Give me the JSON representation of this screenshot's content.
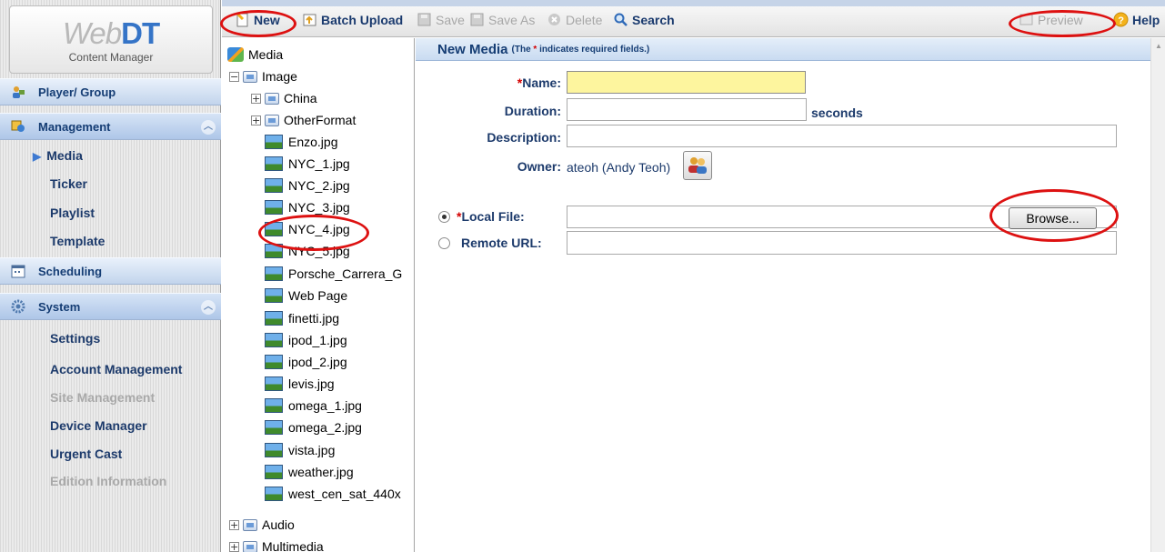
{
  "app": {
    "brand_light": "Web",
    "brand_bold": "DT",
    "subtitle": "Content Manager"
  },
  "toolbar": {
    "new": "New",
    "batch_upload": "Batch Upload",
    "save": "Save",
    "save_as": "Save As",
    "delete": "Delete",
    "search": "Search",
    "preview": "Preview",
    "help": "Help"
  },
  "sidebar": {
    "sections": {
      "player_group": "Player/ Group",
      "management": "Management",
      "scheduling": "Scheduling",
      "system": "System"
    },
    "management_items": {
      "media": "Media",
      "ticker": "Ticker",
      "playlist": "Playlist",
      "template": "Template"
    },
    "system_items": {
      "settings": "Settings",
      "account_management": "Account Management",
      "site_management": "Site Management",
      "device_manager": "Device Manager",
      "urgent_cast": "Urgent Cast",
      "edition_information": "Edition Information"
    }
  },
  "tree": {
    "root": "Media",
    "image": "Image",
    "folders": {
      "china": "China",
      "otherformat": "OtherFormat"
    },
    "files": [
      "Enzo.jpg",
      "NYC_1.jpg",
      "NYC_2.jpg",
      "NYC_3.jpg",
      "NYC_4.jpg",
      "NYC_5.jpg",
      "Porsche_Carrera_G",
      "Web Page",
      "finetti.jpg",
      "ipod_1.jpg",
      "ipod_2.jpg",
      "levis.jpg",
      "omega_1.jpg",
      "omega_2.jpg",
      "vista.jpg",
      "weather.jpg",
      "west_cen_sat_440x"
    ],
    "audio": "Audio",
    "multimedia": "Multimedia"
  },
  "form": {
    "title": "New Media",
    "note_prefix": "(The ",
    "note_star": "*",
    "note_suffix": " indicates required fields.)",
    "required_mark": "*",
    "name_label": "Name:",
    "name_value": "",
    "duration_label": "Duration:",
    "duration_value": "",
    "duration_unit": "seconds",
    "description_label": "Description:",
    "description_value": "",
    "owner_label": "Owner:",
    "owner_value": "ateoh (Andy Teoh)",
    "local_file_label": "Local File:",
    "local_file_value": "",
    "local_file_selected": true,
    "browse_button": "Browse...",
    "remote_url_label": "Remote URL:",
    "remote_url_value": ""
  },
  "colors": {
    "annotation_red": "#dd1111",
    "required_red": "#d40000",
    "name_highlight": "#fdf59e",
    "nav_blue": "#1c3a6b"
  }
}
